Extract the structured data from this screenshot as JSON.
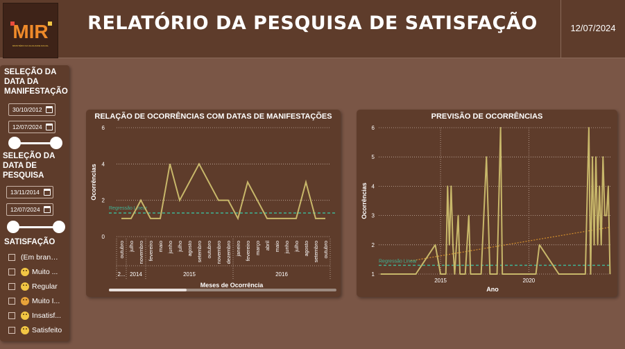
{
  "header": {
    "title": "RELATÓRIO DA PESQUISA DE SATISFAÇÃO",
    "date": "12/07/2024",
    "logo_text": "MIR",
    "logo_subtext": "MINISTÉRIO DA IGUALDADE RACIAL"
  },
  "sidebar": {
    "manifest_heading": "SELEÇÃO DA DATA DA MANIFESTAÇÃO",
    "manifest_start": "30/10/2012",
    "manifest_end": "12/07/2024",
    "manifest_slider": [
      0,
      1
    ],
    "survey_heading": "SELEÇÃO DA DATA DE PESQUISA",
    "survey_start": "13/11/2014",
    "survey_end": "12/07/2024",
    "survey_slider": [
      0,
      1
    ],
    "satisfaction_heading": "SATISFAÇÃO",
    "options": [
      {
        "label": "(Em branco)",
        "icon": "none",
        "checked": false
      },
      {
        "label": "Muito ...",
        "icon": "very-happy-emoji-icon",
        "checked": false
      },
      {
        "label": "Regular",
        "icon": "neutral-emoji-icon",
        "checked": false
      },
      {
        "label": "Muito I...",
        "icon": "very-unhappy-emoji-icon",
        "checked": false
      },
      {
        "label": "Insatisf...",
        "icon": "sad-emoji-icon",
        "checked": false
      },
      {
        "label": "Satisfeito",
        "icon": "happy-emoji-icon",
        "checked": false
      }
    ]
  },
  "colors": {
    "background": "#7a5646",
    "panel": "#5e3c2b",
    "line": "#c8b76a",
    "regression": "#3fb394",
    "trend": "#d7922c"
  },
  "chart_data": [
    {
      "type": "line",
      "title": "RELAÇÃO DE OCORRÊNCIAS COM DATAS DE MANIFESTAÇÕES",
      "xlabel": "Meses de Ocorrência",
      "ylabel": "Ocorrências",
      "ylim": [
        0,
        6
      ],
      "yticks": [
        0,
        2,
        4,
        6
      ],
      "categories": [
        "outubro",
        "julho",
        "novembro",
        "fevereiro",
        "maio",
        "junho",
        "julho",
        "agosto",
        "setembro",
        "outubro",
        "novembro",
        "dezembro",
        "janeiro",
        "fevereiro",
        "março",
        "abril",
        "maio",
        "junho",
        "julho",
        "agosto",
        "setembro",
        "outubro"
      ],
      "year_groups": [
        {
          "label": "2...",
          "count": 1
        },
        {
          "label": "2014",
          "count": 2
        },
        {
          "label": "2015",
          "count": 9
        },
        {
          "label": "2016",
          "count": 10
        }
      ],
      "series": [
        {
          "values": [
            1,
            1,
            2,
            1,
            1,
            4,
            2,
            3,
            4,
            3,
            2,
            2,
            1,
            3,
            2,
            1,
            1,
            1,
            1,
            3,
            1,
            1
          ]
        }
      ],
      "regression_label": "Regressão Linear",
      "regression_value": 1.3,
      "grid": true,
      "scrollbar": {
        "start": 0,
        "end": 0.34
      }
    },
    {
      "type": "line",
      "title": "PREVISÃO DE OCORRÊNCIAS",
      "xlabel": "Ano",
      "ylabel": "Ocorrências",
      "ylim": [
        1,
        6
      ],
      "yticks": [
        1,
        2,
        3,
        4,
        5,
        6
      ],
      "xlim": [
        2011.5,
        2024.7
      ],
      "xticks": [
        2015,
        2020
      ],
      "series": [
        {
          "points": [
            [
              2011.6,
              1
            ],
            [
              2013.6,
              1
            ],
            [
              2014.7,
              2
            ],
            [
              2015.0,
              1
            ],
            [
              2015.3,
              1
            ],
            [
              2015.4,
              4
            ],
            [
              2015.5,
              2
            ],
            [
              2015.6,
              4
            ],
            [
              2015.7,
              2
            ],
            [
              2015.8,
              1
            ],
            [
              2016.0,
              3
            ],
            [
              2016.1,
              1
            ],
            [
              2016.2,
              1
            ],
            [
              2016.4,
              1
            ],
            [
              2016.6,
              3
            ],
            [
              2016.7,
              1
            ],
            [
              2016.9,
              1
            ],
            [
              2017.3,
              1
            ],
            [
              2017.6,
              5
            ],
            [
              2017.8,
              1
            ],
            [
              2018.2,
              1
            ],
            [
              2018.4,
              6
            ],
            [
              2018.5,
              1
            ],
            [
              2019.0,
              1
            ],
            [
              2020.4,
              1
            ],
            [
              2020.6,
              2
            ],
            [
              2021.7,
              1
            ],
            [
              2022.9,
              1
            ],
            [
              2023.2,
              1
            ],
            [
              2023.4,
              6
            ],
            [
              2023.5,
              1
            ],
            [
              2023.6,
              5
            ],
            [
              2023.7,
              2
            ],
            [
              2023.8,
              5
            ],
            [
              2023.9,
              2
            ],
            [
              2024.0,
              4
            ],
            [
              2024.1,
              2
            ],
            [
              2024.2,
              5
            ],
            [
              2024.3,
              3
            ],
            [
              2024.4,
              3
            ],
            [
              2024.5,
              4
            ],
            [
              2024.6,
              1
            ]
          ]
        }
      ],
      "regression_label": "Regressão Linear",
      "regression_value": 1.3,
      "trend": {
        "from": [
          2013.3,
          1.45
        ],
        "to": [
          2024.6,
          2.6
        ]
      },
      "grid": true
    }
  ]
}
